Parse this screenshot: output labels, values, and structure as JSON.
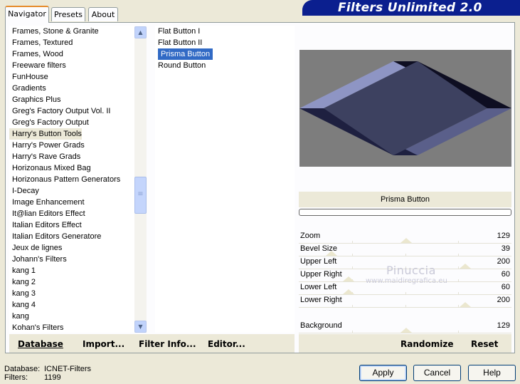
{
  "tabs": [
    "Navigator",
    "Presets",
    "About"
  ],
  "banner_title": "Filters Unlimited 2.0",
  "categories": [
    "Frames, Stone & Granite",
    "Frames, Textured",
    "Frames, Wood",
    "Freeware filters",
    "FunHouse",
    "Gradients",
    "Graphics Plus",
    "Greg's Factory Output Vol. II",
    "Greg's Factory Output",
    "Harry's Button Tools",
    "Harry's Power Grads",
    "Harry's Rave Grads",
    "Horizonaus Mixed Bag",
    "Horizonaus Pattern Generators",
    "I-Decay",
    "Image Enhancement",
    "It@lian Editors Effect",
    "Italian Editors Effect",
    "Italian Editors Generatore",
    "Jeux de lignes",
    "Johann's Filters",
    "kang 1",
    "kang 2",
    "kang 3",
    "kang 4",
    "kang",
    "Kohan's Filters"
  ],
  "selected_category": "Harry's Button Tools",
  "filters": [
    "Flat Button I",
    "Flat Button II",
    "Prisma Button",
    "Round Button"
  ],
  "selected_filter": "Prisma Button",
  "left_buttons": {
    "database": "Database",
    "import": "Import...",
    "filter_info": "Filter Info...",
    "editor": "Editor..."
  },
  "preview_filter_name": "Prisma Button",
  "progress": 0,
  "params": [
    {
      "label": "Zoom",
      "value": "129",
      "level": 0.506
    },
    {
      "label": "Bevel Size",
      "value": "39",
      "level": 0.153
    },
    {
      "label": "Upper Left",
      "value": "200",
      "level": 0.784
    },
    {
      "label": "Upper Right",
      "value": "60",
      "level": 0.235
    },
    {
      "label": "Lower Left",
      "value": "60",
      "level": 0.235
    },
    {
      "label": "Lower Right",
      "value": "200",
      "level": 0.784
    },
    {
      "label": "",
      "value": "",
      "level": null
    },
    {
      "label": "Background",
      "value": "129",
      "level": 0.506
    }
  ],
  "right_buttons": {
    "randomize": "Randomize",
    "reset": "Reset"
  },
  "watermark": {
    "name": "Pinuccia",
    "url": "www.maidiregrafica.eu"
  },
  "status": {
    "database_label": "Database:",
    "database_value": "ICNET-Filters",
    "filters_label": "Filters:",
    "filters_value": "1199"
  },
  "dialog_buttons": {
    "apply": "Apply",
    "cancel": "Cancel",
    "help": "Help"
  },
  "colors": {
    "accent": "#0b1f8f",
    "selection": "#316ac5",
    "preview_bg": "#7d7d7d",
    "button_face": "#3d4160",
    "bevel_light": "#8e95c4",
    "bevel_dark": "#0e0e22"
  },
  "icons": [
    "scroll-up-icon",
    "scroll-down-icon",
    "scroll-grip-icon"
  ]
}
